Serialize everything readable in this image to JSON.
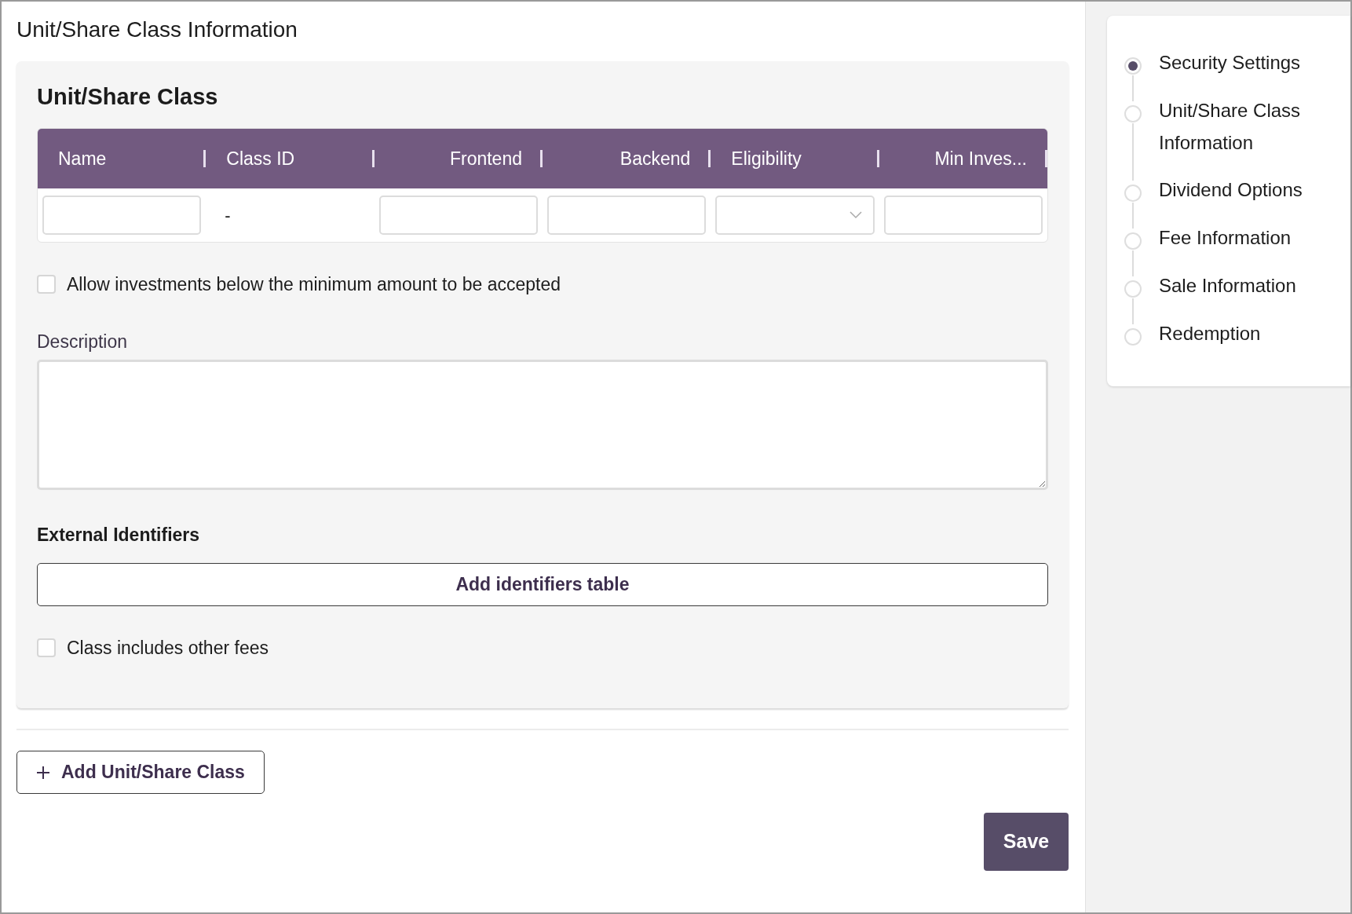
{
  "page_title": "Unit/Share Class Information",
  "card": {
    "title": "Unit/Share Class",
    "table": {
      "columns": [
        "Name",
        "Class ID",
        "Frontend",
        "Backend",
        "Eligibility",
        "Min Inves..."
      ],
      "rows": [
        {
          "cells": [
            {
              "kind": "input"
            },
            {
              "kind": "text",
              "text": "-"
            },
            {
              "kind": "input"
            },
            {
              "kind": "input"
            },
            {
              "kind": "select"
            },
            {
              "kind": "input"
            }
          ]
        }
      ]
    },
    "allow_below_minimum": {
      "label": "Allow investments below the minimum amount to be accepted",
      "checked": false
    },
    "description": {
      "label": "Description"
    },
    "external_identifiers": {
      "heading": "External Identifiers",
      "button": "Add identifiers table"
    },
    "other_fees": {
      "label": "Class includes other fees",
      "checked": false
    }
  },
  "add_class_button": "Add Unit/Share Class",
  "save_button": "Save",
  "steps": [
    {
      "label": "Security Settings",
      "selected": true
    },
    {
      "label": "Unit/Share Class Information",
      "selected": false
    },
    {
      "label": "Dividend Options",
      "selected": false
    },
    {
      "label": "Fee Information",
      "selected": false
    },
    {
      "label": "Sale Information",
      "selected": false
    },
    {
      "label": "Redemption",
      "selected": false
    }
  ]
}
